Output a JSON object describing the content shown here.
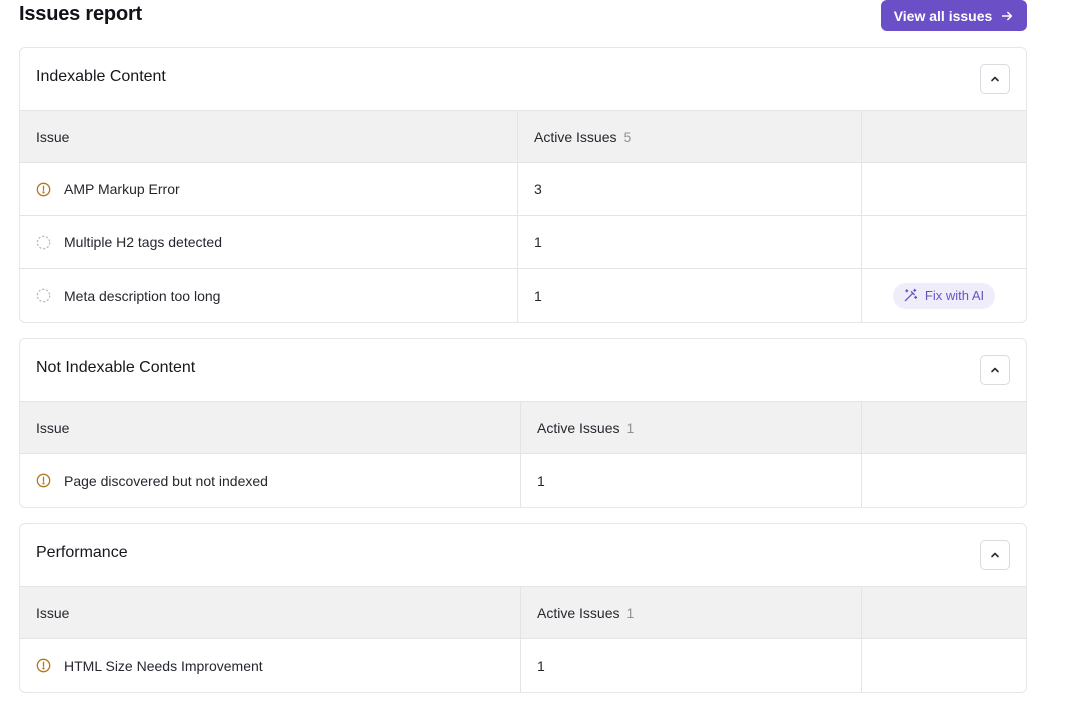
{
  "header": {
    "title": "Issues report",
    "view_all_label": "View all issues"
  },
  "columns": {
    "issue": "Issue",
    "active": "Active Issues"
  },
  "fix_ai_label": "Fix with AI",
  "colors": {
    "accent": "#6a4fc7",
    "warning": "#b07a1c",
    "pending": "#b9bcc3"
  },
  "sections": [
    {
      "title": "Indexable Content",
      "active_total": "5",
      "rows": [
        {
          "icon": "warning-circle-icon",
          "issue": "AMP Markup Error",
          "count": "3"
        },
        {
          "icon": "dashed-circle-icon",
          "issue": "Multiple H2 tags detected",
          "count": "1"
        },
        {
          "icon": "dashed-circle-icon",
          "issue": "Meta description too long",
          "count": "1",
          "action": "Fix with AI"
        }
      ]
    },
    {
      "title": "Not Indexable Content",
      "active_total": "1",
      "rows": [
        {
          "icon": "warning-circle-icon",
          "issue": "Page discovered but not indexed",
          "count": "1"
        }
      ]
    },
    {
      "title": "Performance",
      "active_total": "1",
      "rows": [
        {
          "icon": "warning-circle-icon",
          "issue": "HTML Size Needs Improvement",
          "count": "1"
        }
      ]
    }
  ]
}
